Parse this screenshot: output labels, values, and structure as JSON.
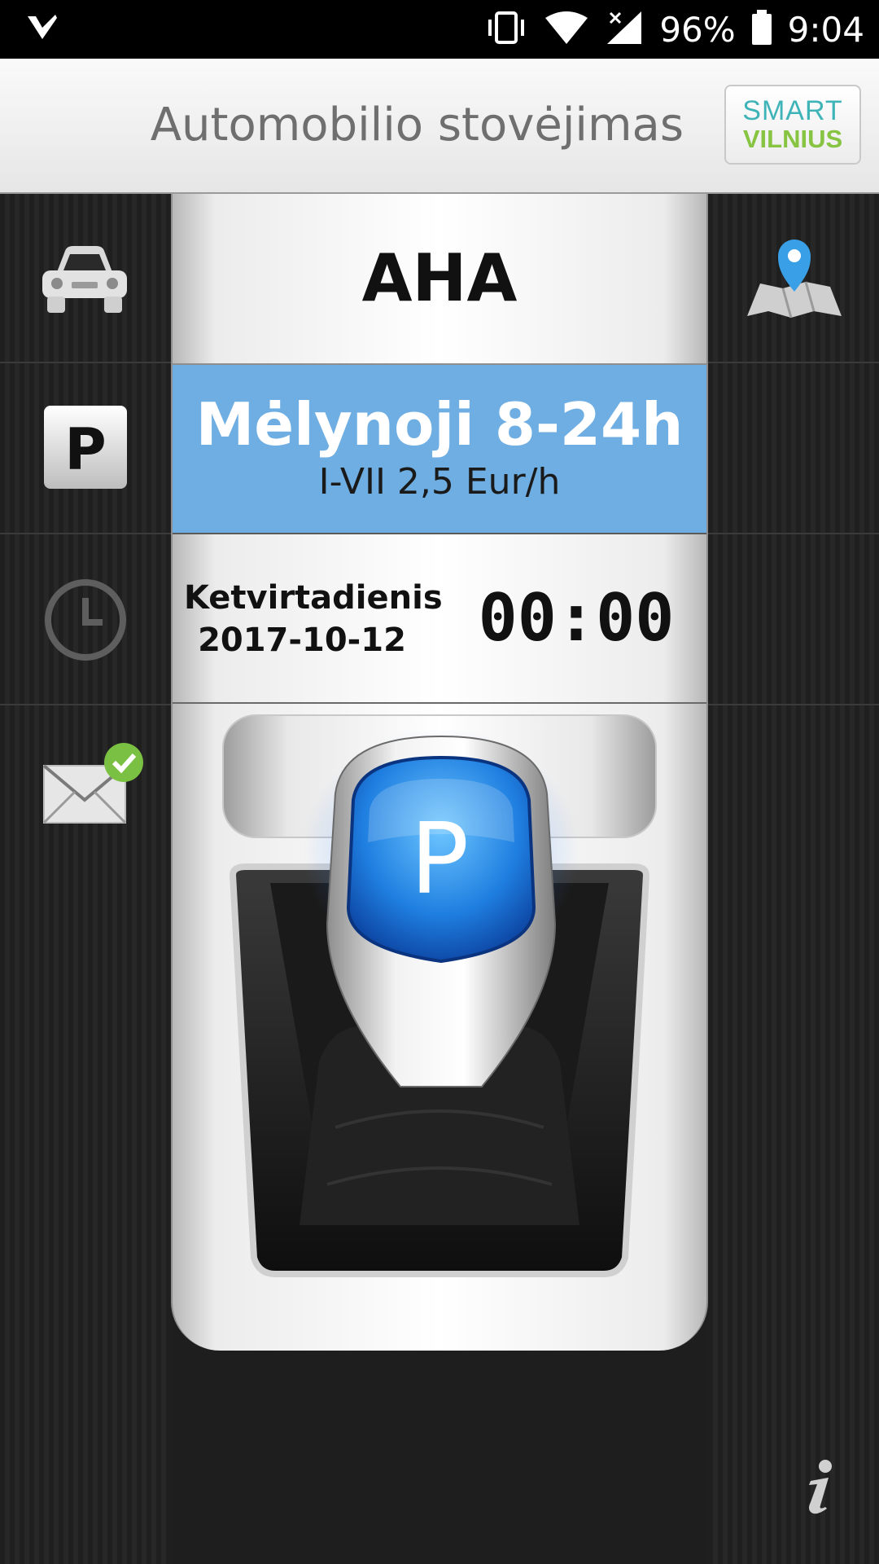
{
  "status_bar": {
    "battery": "96%",
    "time": "9:04"
  },
  "header": {
    "title": "Automobilio stovėjimas",
    "logo_line1": "SMART",
    "logo_line2": "VILNIUS"
  },
  "car": {
    "plate": "AHA"
  },
  "zone": {
    "name": "Mėlynoji 8-24h",
    "rate": "I-VII 2,5 Eur/h"
  },
  "time_row": {
    "day": "Ketvirtadienis",
    "date": "2017-10-12",
    "duration": "00:00"
  },
  "gear": {
    "label": "P"
  },
  "colors": {
    "zone_blue": "#6eaee2",
    "gear_blue": "#1f7fe0",
    "logo_teal": "#3fb4b8",
    "logo_green": "#86c441"
  },
  "icons": [
    "car-icon",
    "map-pin-icon",
    "parking-icon",
    "clock-icon",
    "mail-check-icon",
    "info-icon"
  ]
}
